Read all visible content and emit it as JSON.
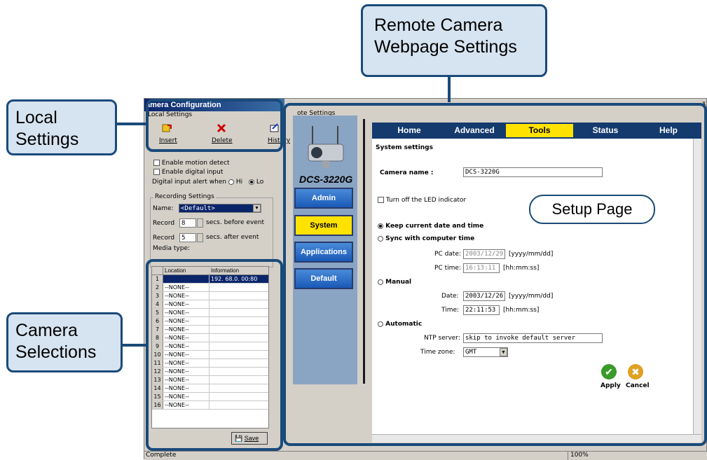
{
  "callouts": {
    "remote": "Remote Camera Webpage Settings",
    "local": "Local Settings",
    "camera": "Camera Selections",
    "setup_page": "Setup Page"
  },
  "window": {
    "title": "amera Configuration",
    "remote_group": "ote Settings",
    "status_left": "Complete",
    "status_right": "100%",
    "close": "x"
  },
  "local": {
    "group": "Local Settings",
    "insert": "Insert",
    "delete": "Delete",
    "history": "History",
    "enable_motion": "Enable motion detect",
    "enable_digital": "Enable digital input",
    "alert_when": "Digital input alert when",
    "alert_hi": "Hi",
    "alert_lo": "Lo",
    "recording_group": "Recording Settings",
    "name_label": "Name:",
    "name_value": "<Default>",
    "record1_label": "Record",
    "record1_value": "8",
    "record1_suffix": "secs. before event",
    "record2_label": "Record",
    "record2_value": "5",
    "record2_suffix": "secs. after event",
    "media_type": "Media type:"
  },
  "camera_table": {
    "columns": [
      "",
      "Location",
      "Information"
    ],
    "rows": [
      {
        "n": "1",
        "location": "",
        "info": "192. 68.0. 00:80"
      },
      {
        "n": "2",
        "location": "--NONE--",
        "info": ""
      },
      {
        "n": "3",
        "location": "--NONE--",
        "info": ""
      },
      {
        "n": "4",
        "location": "--NONE--",
        "info": ""
      },
      {
        "n": "5",
        "location": "--NONE--",
        "info": ""
      },
      {
        "n": "6",
        "location": "--NONE--",
        "info": ""
      },
      {
        "n": "7",
        "location": "--NONE--",
        "info": ""
      },
      {
        "n": "8",
        "location": "--NONE--",
        "info": ""
      },
      {
        "n": "9",
        "location": "--NONE--",
        "info": ""
      },
      {
        "n": "10",
        "location": "--NONE--",
        "info": ""
      },
      {
        "n": "11",
        "location": "--NONE--",
        "info": ""
      },
      {
        "n": "12",
        "location": "--NONE--",
        "info": ""
      },
      {
        "n": "13",
        "location": "--NONE--",
        "info": ""
      },
      {
        "n": "14",
        "location": "--NONE--",
        "info": ""
      },
      {
        "n": "15",
        "location": "--NONE--",
        "info": ""
      },
      {
        "n": "16",
        "location": "--NONE--",
        "info": ""
      }
    ],
    "save": "Save"
  },
  "device": {
    "model": "DCS-3220G",
    "nav": [
      "Admin",
      "System",
      "Applications",
      "Default"
    ],
    "active_nav": "System"
  },
  "tabs": [
    "Home",
    "Advanced",
    "Tools",
    "Status",
    "Help"
  ],
  "active_tab": "Tools",
  "system": {
    "heading": "System settings",
    "camera_name_label": "Camera name :",
    "camera_name_value": "DCS-3220G",
    "led_label": "Turn off the LED indicator",
    "keep_label": "Keep current date and time",
    "sync_label": "Sync with computer time",
    "pc_date_label": "PC date:",
    "pc_date_value": "2003/12/29",
    "pc_date_fmt": "[yyyy/mm/dd]",
    "pc_time_label": "PC time:",
    "pc_time_value": "16:13:11",
    "pc_time_fmt": "[hh:mm:ss]",
    "manual_label": "Manual",
    "date_label": "Date:",
    "date_value": "2003/12/26",
    "date_fmt": "[yyyy/mm/dd]",
    "time_label": "Time:",
    "time_value": "22:11:53",
    "time_fmt": "[hh:mm:ss]",
    "auto_label": "Automatic",
    "ntp_label": "NTP server:",
    "ntp_value": "skip to invoke default server",
    "tz_label": "Time zone:",
    "tz_value": "GMT",
    "apply": "Apply",
    "cancel": "Cancel"
  },
  "colors": {
    "callout_fill": "#d6e3f0",
    "callout_border": "#1a4a7a",
    "nav_blue": "#1a5ab8",
    "active_yellow": "#ffe200",
    "tab_navy": "#143a6e"
  }
}
